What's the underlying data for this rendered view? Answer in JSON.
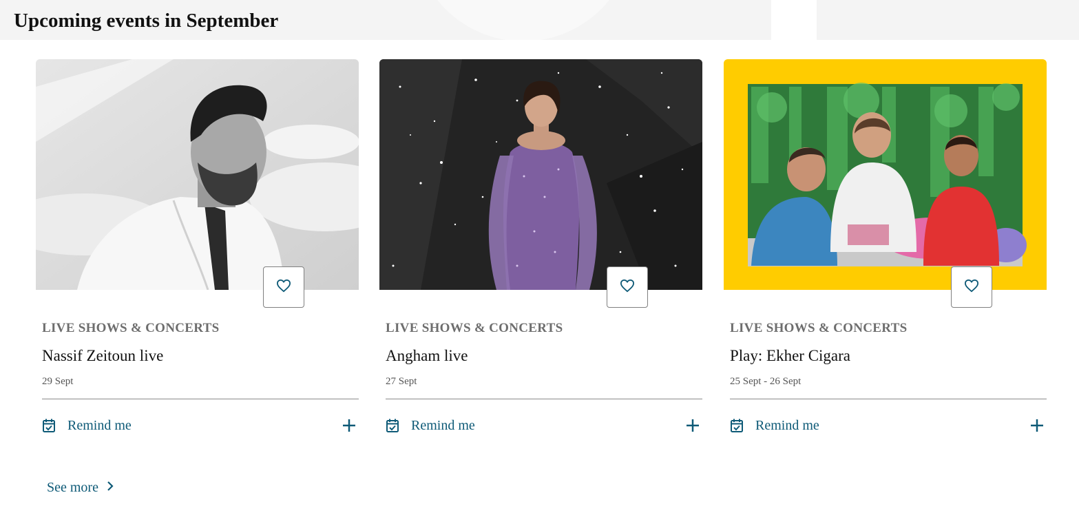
{
  "page": {
    "title": "Upcoming events in September"
  },
  "cards": [
    {
      "category": "LIVE SHOWS & CONCERTS",
      "title": "Nassif Zeitoun live",
      "date": "29 Sept",
      "remind_label": "Remind me",
      "image_desc": "black-and-white portrait of male singer"
    },
    {
      "category": "LIVE SHOWS & CONCERTS",
      "title": "Angham live",
      "date": "27 Sept",
      "remind_label": "Remind me",
      "image_desc": "singer in sparkly purple dress on dark background"
    },
    {
      "category": "LIVE SHOWS & CONCERTS",
      "title": "Play: Ekher Cigara",
      "date": "25 Sept - 26 Sept",
      "remind_label": "Remind me",
      "image_desc": "three men laughing, yellow frame, green trees"
    }
  ],
  "see_more": {
    "label": "See more"
  },
  "icons": {
    "favorite": "heart-icon",
    "remind": "calendar-check-icon",
    "add": "plus-icon",
    "see_more": "chevron-right-icon"
  },
  "colors": {
    "accent": "#0e5a77",
    "category": "#6d6d6d",
    "header_band": "#f4f4f4",
    "frame_yellow": "#ffcc00"
  }
}
